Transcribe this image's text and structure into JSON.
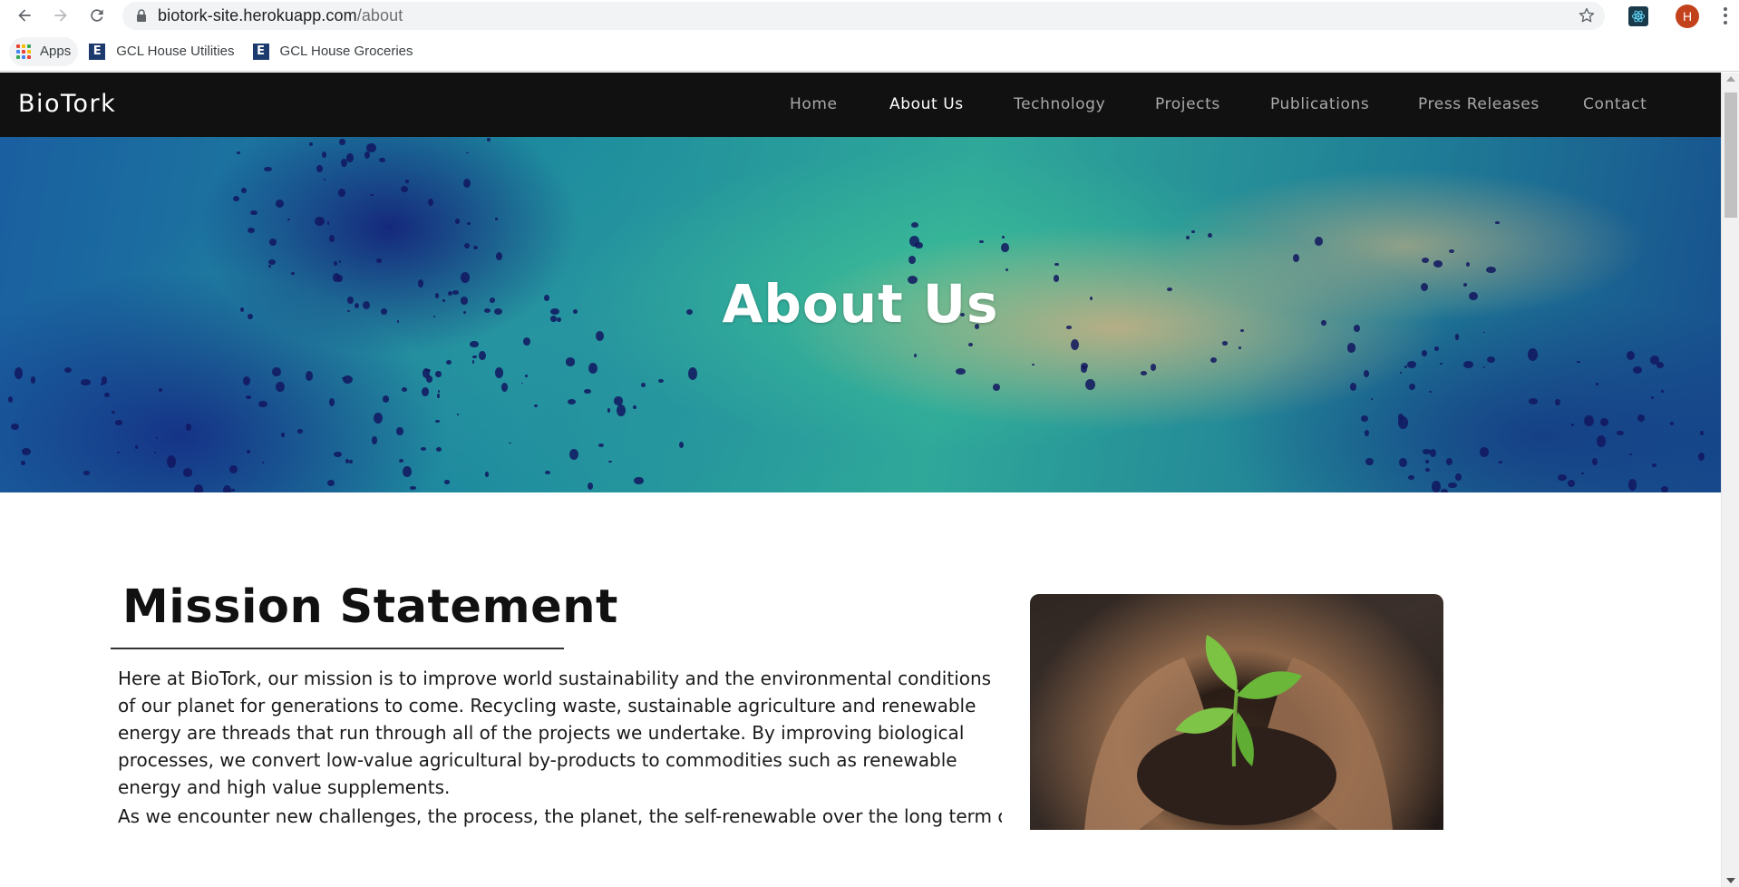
{
  "browser": {
    "url_host": "biotork-site.herokuapp.com",
    "url_path": "/about",
    "profile_initial": "H",
    "bookmarks": [
      {
        "label": "Apps",
        "icon": "apps-grid-icon"
      },
      {
        "label": "GCL House Utilities",
        "icon": "e-favicon-icon"
      },
      {
        "label": "GCL House Groceries",
        "icon": "e-favicon-icon"
      }
    ]
  },
  "site": {
    "brand": "BioTork",
    "nav": [
      {
        "label": "Home",
        "active": false
      },
      {
        "label": "About Us",
        "active": true
      },
      {
        "label": "Technology",
        "active": false
      },
      {
        "label": "Projects",
        "active": false
      },
      {
        "label": "Publications",
        "active": false
      },
      {
        "label": "Press Releases",
        "active": false
      },
      {
        "label": "Contact",
        "active": false
      }
    ]
  },
  "hero": {
    "title": "About Us"
  },
  "mission": {
    "title": "Mission Statement",
    "paragraph": "Here at BioTork, our mission is to improve world sustainability and the environmental conditions of our planet for generations to come. Recycling waste, sustainable agriculture and renewable energy are threads that run through all of the projects we undertake. By improving biological processes, we convert low-value agricultural by-products to commodities such as renewable energy and high value supplements.",
    "paragraph_2_partial": "As we encounter new challenges, the process, the planet, the self-renewable over the long term of"
  },
  "colors": {
    "nav_bg": "#111111",
    "nav_active": "#ffffff",
    "nav_inactive": "#a9a9a9",
    "avatar_bg": "#c2421c"
  }
}
